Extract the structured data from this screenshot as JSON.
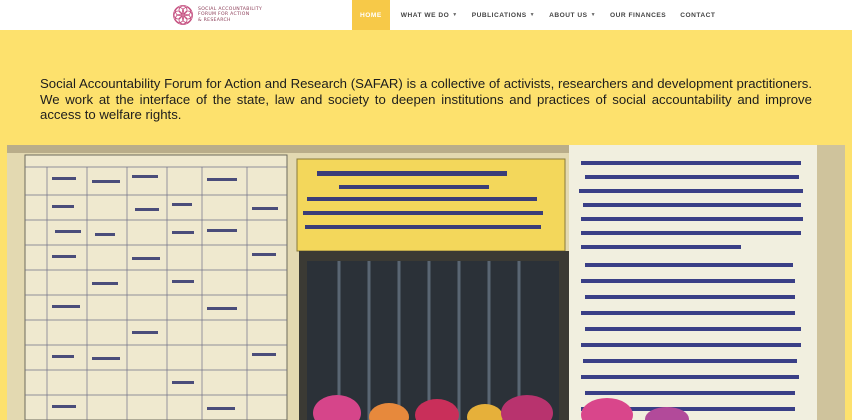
{
  "header": {
    "logo_text": [
      "SOCIAL ACCOUNTABILITY",
      "FORUM FOR ACTION",
      "& RESEARCH"
    ],
    "nav": [
      {
        "label": "HOME",
        "active": true,
        "dropdown": false
      },
      {
        "label": "WHAT WE DO",
        "active": false,
        "dropdown": true
      },
      {
        "label": "PUBLICATIONS",
        "active": false,
        "dropdown": true
      },
      {
        "label": "ABOUT US",
        "active": false,
        "dropdown": true
      },
      {
        "label": "OUR FINANCES",
        "active": false,
        "dropdown": false
      },
      {
        "label": "CONTACT",
        "active": false,
        "dropdown": false
      }
    ]
  },
  "intro": {
    "text": "Social Accountability Forum for Action and Research (SAFAR) is a collective of activists, researchers and development practitioners. We work at the interface of the state, law and society to deepen institutions and practices of social accountability and improve access to welfare rights."
  },
  "colors": {
    "page_background": "#fde16d",
    "nav_active": "#f7c948",
    "logo_accent": "#c2477a"
  },
  "photo": {
    "icon": "wall-mural-photo"
  }
}
